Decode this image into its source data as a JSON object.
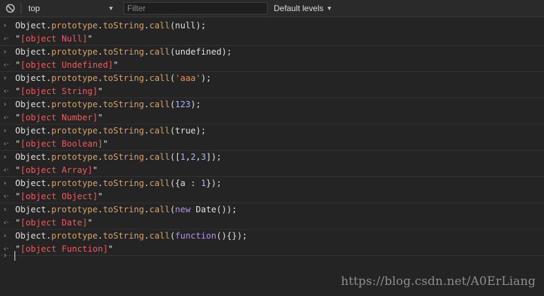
{
  "toolbar": {
    "context": "top",
    "filter_placeholder": "Filter",
    "levels_label": "Default levels"
  },
  "entries": [
    {
      "input": {
        "prefix": "Object.",
        "p1": "prototype",
        "dot": ".",
        "p2": "toString",
        "dot2": ".",
        "p3": "call",
        "open": "(",
        "arg": "null",
        "close": ");"
      },
      "result": {
        "q1": "\"",
        "val": "[object Null]",
        "q2": "\""
      }
    },
    {
      "input": {
        "prefix": "Object.",
        "p1": "prototype",
        "dot": ".",
        "p2": "toString",
        "dot2": ".",
        "p3": "call",
        "open": "(",
        "arg": "undefined",
        "close": ");"
      },
      "result": {
        "q1": "\"",
        "val": "[object Undefined]",
        "q2": "\""
      }
    },
    {
      "input": {
        "prefix": "Object.",
        "p1": "prototype",
        "dot": ".",
        "p2": "toString",
        "dot2": ".",
        "p3": "call",
        "open": "(",
        "arg": "'aaa'",
        "close": ");"
      },
      "result": {
        "q1": "\"",
        "val": "[object String]",
        "q2": "\""
      }
    },
    {
      "input": {
        "prefix": "Object.",
        "p1": "prototype",
        "dot": ".",
        "p2": "toString",
        "dot2": ".",
        "p3": "call",
        "open": "(",
        "arg": "123",
        "close": ");"
      },
      "result": {
        "q1": "\"",
        "val": "[object Number]",
        "q2": "\""
      }
    },
    {
      "input": {
        "prefix": "Object.",
        "p1": "prototype",
        "dot": ".",
        "p2": "toString",
        "dot2": ".",
        "p3": "call",
        "open": "(",
        "arg": "true",
        "close": ");"
      },
      "result": {
        "q1": "\"",
        "val": "[object Boolean]",
        "q2": "\""
      }
    },
    {
      "input": {
        "prefix": "Object.",
        "p1": "prototype",
        "dot": ".",
        "p2": "toString",
        "dot2": ".",
        "p3": "call",
        "open": "(",
        "arg": "[1,2,3]",
        "close": ");"
      },
      "result": {
        "q1": "\"",
        "val": "[object Array]",
        "q2": "\""
      }
    },
    {
      "input": {
        "prefix": "Object.",
        "p1": "prototype",
        "dot": ".",
        "p2": "toString",
        "dot2": ".",
        "p3": "call",
        "open": "(",
        "arg": "{a : 1}",
        "close": ");"
      },
      "result": {
        "q1": "\"",
        "val": "[object Object]",
        "q2": "\""
      }
    },
    {
      "input": {
        "prefix": "Object.",
        "p1": "prototype",
        "dot": ".",
        "p2": "toString",
        "dot2": ".",
        "p3": "call",
        "open": "(",
        "arg": "new Date()",
        "close": ");"
      },
      "result": {
        "q1": "\"",
        "val": "[object Date]",
        "q2": "\""
      }
    },
    {
      "input": {
        "prefix": "Object.",
        "p1": "prototype",
        "dot": ".",
        "p2": "toString",
        "dot2": ".",
        "p3": "call",
        "open": "(",
        "arg": "function(){}",
        "close": ");"
      },
      "result": {
        "q1": "\"",
        "val": "[object Function]",
        "q2": "\""
      }
    }
  ],
  "gutter": {
    "input_glyph": "›",
    "result_glyph": "‹·"
  },
  "prompt_glyph": "›",
  "watermark": "https://blog.csdn.net/A0ErLiang",
  "icons": {
    "clear": "block-icon",
    "levels": "triangle-down-icon",
    "context": "triangle-down-icon"
  },
  "colors": {
    "property": "#d3a36a",
    "number": "#a8b7ff",
    "string": "#f28b54",
    "keyword": "#b495e8",
    "result_value": "#ef5b5b",
    "prompt": "#3b9af5"
  }
}
